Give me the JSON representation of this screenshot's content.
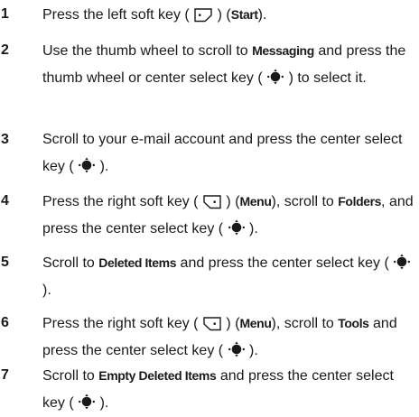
{
  "steps": [
    {
      "number": "1",
      "parts": [
        {
          "t": "text",
          "v": "Press the left soft key ("
        },
        {
          "t": "icon",
          "v": "left-soft-key"
        },
        {
          "t": "text",
          "v": ") ("
        },
        {
          "t": "key",
          "v": "Start"
        },
        {
          "t": "text",
          "v": ")."
        }
      ]
    },
    {
      "number": "2",
      "parts": [
        {
          "t": "text",
          "v": "Use the thumb wheel to scroll to "
        },
        {
          "t": "key",
          "v": "Messaging"
        },
        {
          "t": "text",
          "v": " and press the thumb wheel or center select key ("
        },
        {
          "t": "icon",
          "v": "center-select-key"
        },
        {
          "t": "text",
          "v": ") to select it."
        }
      ]
    },
    {
      "number": "3",
      "parts": [
        {
          "t": "text",
          "v": "Scroll to your e-mail account and press the center select key ("
        },
        {
          "t": "icon",
          "v": "center-select-key"
        },
        {
          "t": "text",
          "v": ")."
        }
      ]
    },
    {
      "number": "4",
      "parts": [
        {
          "t": "text",
          "v": "Press the right soft key ("
        },
        {
          "t": "icon",
          "v": "right-soft-key"
        },
        {
          "t": "text",
          "v": ") ("
        },
        {
          "t": "key",
          "v": "Menu"
        },
        {
          "t": "text",
          "v": "), scroll to "
        },
        {
          "t": "key",
          "v": "Folders"
        },
        {
          "t": "text",
          "v": ", and press the center select key ("
        },
        {
          "t": "icon",
          "v": "center-select-key"
        },
        {
          "t": "text",
          "v": ")."
        }
      ]
    },
    {
      "number": "5",
      "parts": [
        {
          "t": "text",
          "v": "Scroll to "
        },
        {
          "t": "key",
          "v": "Deleted Items"
        },
        {
          "t": "text",
          "v": " and press the center select key ("
        },
        {
          "t": "icon",
          "v": "center-select-key"
        },
        {
          "t": "text",
          "v": ")."
        }
      ]
    },
    {
      "number": "6",
      "parts": [
        {
          "t": "text",
          "v": "Press the right soft key ("
        },
        {
          "t": "icon",
          "v": "right-soft-key"
        },
        {
          "t": "text",
          "v": ") ("
        },
        {
          "t": "key",
          "v": "Menu"
        },
        {
          "t": "text",
          "v": "), scroll to "
        },
        {
          "t": "key",
          "v": "Tools"
        },
        {
          "t": "text",
          "v": " and press the center select key ("
        },
        {
          "t": "icon",
          "v": "center-select-key"
        },
        {
          "t": "text",
          "v": ")."
        }
      ]
    },
    {
      "number": "7",
      "parts": [
        {
          "t": "text",
          "v": "Scroll to "
        },
        {
          "t": "key",
          "v": "Empty Deleted Items"
        },
        {
          "t": "text",
          "v": " and press the center select key ("
        },
        {
          "t": "icon",
          "v": "center-select-key"
        },
        {
          "t": "text",
          "v": ")."
        }
      ]
    }
  ]
}
